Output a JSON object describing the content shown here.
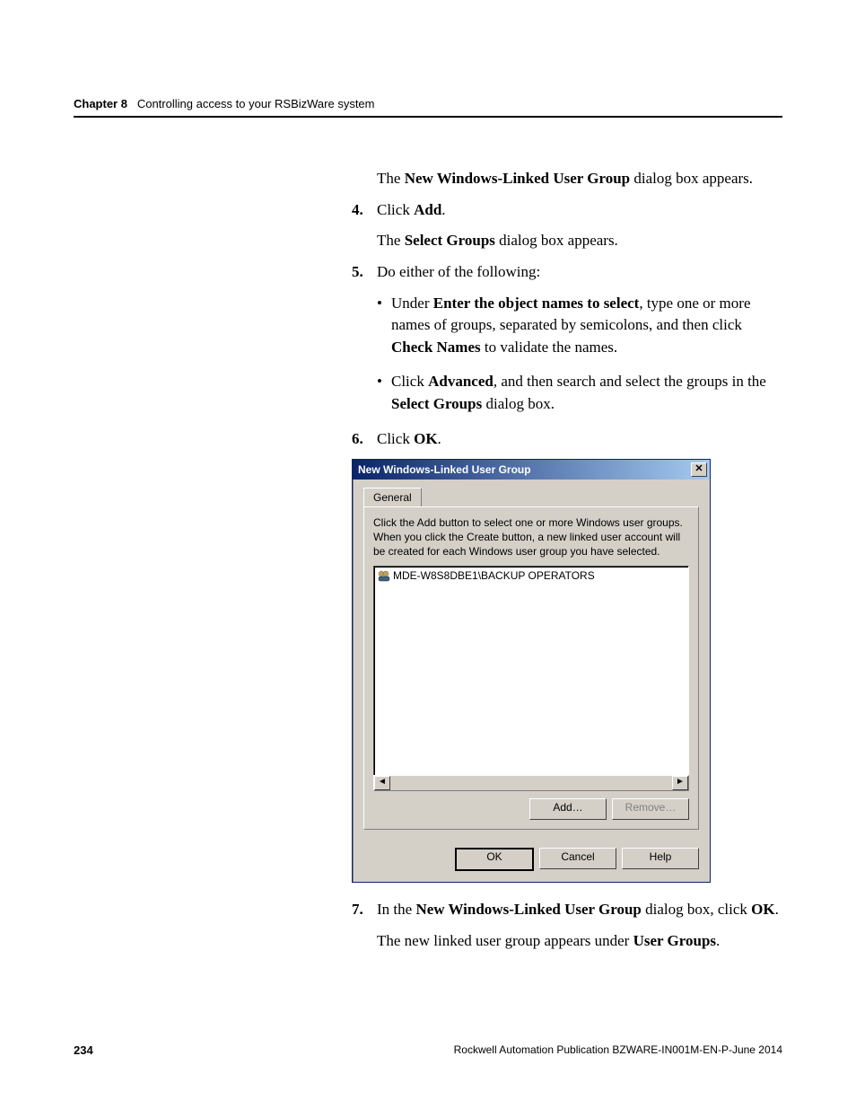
{
  "header": {
    "chapter": "Chapter 8",
    "title": "Controlling access to your RSBizWare system"
  },
  "content": {
    "p1_a": "The ",
    "p1_b": "New Windows-Linked User Group",
    "p1_c": " dialog box appears.",
    "s4_num": "4.",
    "s4_a": "Click ",
    "s4_b": "Add",
    "s4_c": ".",
    "p2_a": "The ",
    "p2_b": "Select Groups",
    "p2_c": " dialog box appears.",
    "s5_num": "5.",
    "s5_text": "Do either of the following:",
    "b1_dot": "•",
    "b1_a": "Under ",
    "b1_b": "Enter the object names to select",
    "b1_c": ", type one or more names of groups, separated by semicolons, and then click ",
    "b1_d": "Check Names",
    "b1_e": " to validate the names.",
    "b2_dot": "•",
    "b2_a": "Click ",
    "b2_b": "Advanced",
    "b2_c": ", and then search and select the groups in the ",
    "b2_d": "Select Groups",
    "b2_e": " dialog box.",
    "s6_num": "6.",
    "s6_a": "Click ",
    "s6_b": "OK",
    "s6_c": ".",
    "s7_num": "7.",
    "s7_a": "In the ",
    "s7_b": "New Windows-Linked User Group",
    "s7_c": " dialog box, click ",
    "s7_d": "OK",
    "s7_e": ".",
    "p3_a": "The new linked user group appears under ",
    "p3_b": "User Groups",
    "p3_c": "."
  },
  "dialog": {
    "title": "New Windows-Linked User Group",
    "close_glyph": "✕",
    "tab_label": "General",
    "instruction": "Click the Add button to select one or more Windows user groups. When you click the Create button, a new linked user account will be created for each Windows user group you have selected.",
    "list_item": "MDE-W8S8DBE1\\BACKUP OPERATORS",
    "scroll_left": "◄",
    "scroll_right": "►",
    "btn_add": "Add…",
    "btn_remove": "Remove…",
    "btn_ok": "OK",
    "btn_cancel": "Cancel",
    "btn_help": "Help"
  },
  "footer": {
    "page": "234",
    "pub": "Rockwell Automation Publication BZWARE-IN001M-EN-P-June 2014"
  }
}
